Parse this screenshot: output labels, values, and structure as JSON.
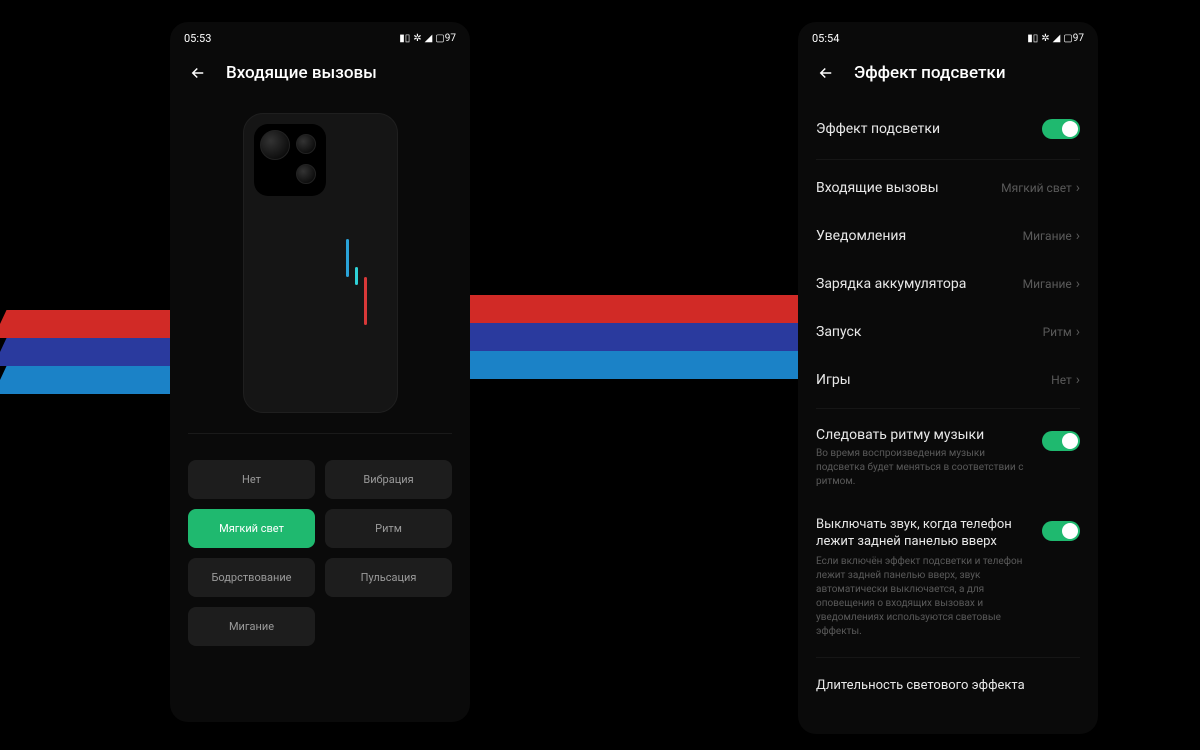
{
  "left": {
    "time": "05:53",
    "battery": "97",
    "title": "Входящие вызовы",
    "options": [
      "Нет",
      "Вибрация",
      "Мягкий свет",
      "Ритм",
      "Бодрствование",
      "Пульсация",
      "Мигание"
    ],
    "active_index": 2
  },
  "right": {
    "time": "05:54",
    "battery": "97",
    "title": "Эффект подсветки",
    "main_toggle": {
      "label": "Эффект подсветки",
      "on": true
    },
    "items": [
      {
        "label": "Входящие вызовы",
        "value": "Мягкий свет"
      },
      {
        "label": "Уведомления",
        "value": "Мигание"
      },
      {
        "label": "Зарядка аккумулятора",
        "value": "Мигание"
      },
      {
        "label": "Запуск",
        "value": "Ритм"
      },
      {
        "label": "Игры",
        "value": "Нет"
      }
    ],
    "music": {
      "label": "Следовать ритму музыки",
      "desc": "Во время воспроизведения музыки подсветка будет меняться в соответствии с ритмом.",
      "on": true
    },
    "mute": {
      "label": "Выключать звук, когда телефон лежит задней панелью вверх",
      "desc": "Если включён эффект подсветки и телефон лежит задней панелью вверх, звук автоматически выключается, а для оповещения о входящих вызовах и уведомлениях используются световые эффекты.",
      "on": true
    },
    "duration_label": "Длительность светового эффекта"
  }
}
